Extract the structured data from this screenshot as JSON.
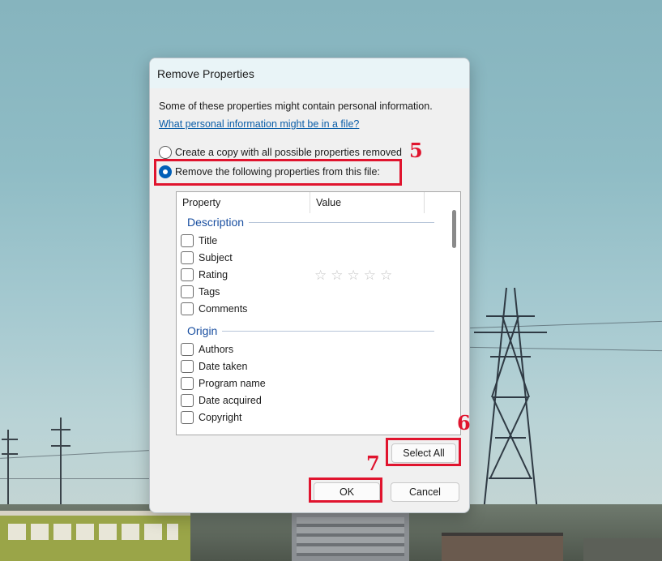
{
  "dialog": {
    "title": "Remove Properties",
    "intro": "Some of these properties might contain personal information.",
    "link": "What personal information might be in a file?",
    "radio_copy": "Create a copy with all possible properties removed",
    "radio_remove": "Remove the following properties from this file:",
    "radio_selected": "radio_remove"
  },
  "list": {
    "columns": [
      "Property",
      "Value"
    ],
    "groups": [
      {
        "title": "Description",
        "items": [
          "Title",
          "Subject",
          "Rating",
          "Tags",
          "Comments"
        ]
      },
      {
        "title": "Origin",
        "items": [
          "Authors",
          "Date taken",
          "Program name",
          "Date acquired",
          "Copyright"
        ]
      }
    ],
    "rating_stars": 5
  },
  "buttons": {
    "select_all": "Select All",
    "ok": "OK",
    "cancel": "Cancel"
  },
  "annotations": {
    "step_5": "5",
    "step_6": "6",
    "step_7": "7",
    "color": "#e0142e"
  },
  "colors": {
    "accent": "#005fb8",
    "link": "#0b5ea8",
    "group_heading": "#1a4fa0"
  }
}
